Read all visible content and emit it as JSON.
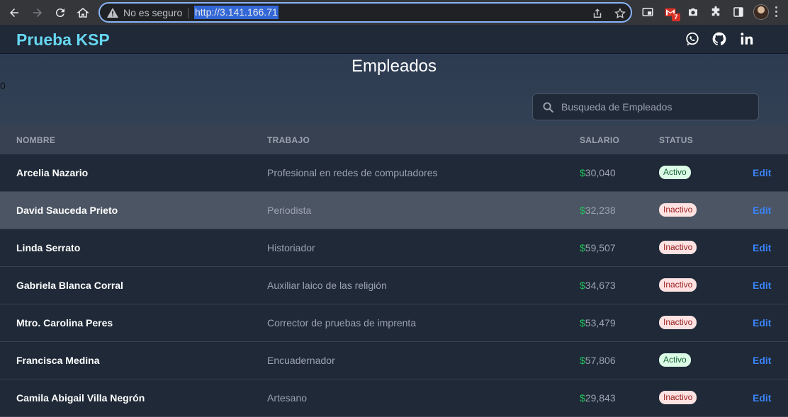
{
  "browser": {
    "security_label": "No es seguro",
    "url": "http://3.141.166.71",
    "mail_badge": "7"
  },
  "header": {
    "brand": "Prueba KSP",
    "social": [
      "whatsapp-icon",
      "github-icon",
      "linkedin-icon"
    ]
  },
  "hero": {
    "title": "Empleados",
    "counter": "0",
    "search_placeholder": "Busqueda de Empleados"
  },
  "table": {
    "columns": {
      "name": "NOMBRE",
      "job": "TRABAJO",
      "salary": "SALARIO",
      "status": "STATUS"
    },
    "currency": "$",
    "edit_label": "Edit",
    "rows": [
      {
        "name": "Arcelia Nazario",
        "job": "Profesional en redes de computadores",
        "salary": "30,040",
        "status": "Activo",
        "active": true
      },
      {
        "name": "David Sauceda Prieto",
        "job": "Periodista",
        "salary": "32,238",
        "status": "Inactivo",
        "active": false
      },
      {
        "name": "Linda Serrato",
        "job": "Historiador",
        "salary": "59,507",
        "status": "Inactivo",
        "active": false
      },
      {
        "name": "Gabriela Blanca Corral",
        "job": "Auxiliar laico de las religión",
        "salary": "34,673",
        "status": "Inactivo",
        "active": false
      },
      {
        "name": "Mtro. Carolina Peres",
        "job": "Corrector de pruebas de imprenta",
        "salary": "53,479",
        "status": "Inactivo",
        "active": false
      },
      {
        "name": "Francisca Medina",
        "job": "Encuadernador",
        "salary": "57,806",
        "status": "Activo",
        "active": true
      },
      {
        "name": "Camila Abigail Villa Negrón",
        "job": "Artesano",
        "salary": "29,843",
        "status": "Inactivo",
        "active": false
      }
    ]
  },
  "colors": {
    "brand": "#67d6f0",
    "salary_currency": "#22c55e",
    "edit_link": "#3b82f6",
    "active_badge_bg": "#dcfce7",
    "inactive_badge_bg": "#fee2e2"
  }
}
